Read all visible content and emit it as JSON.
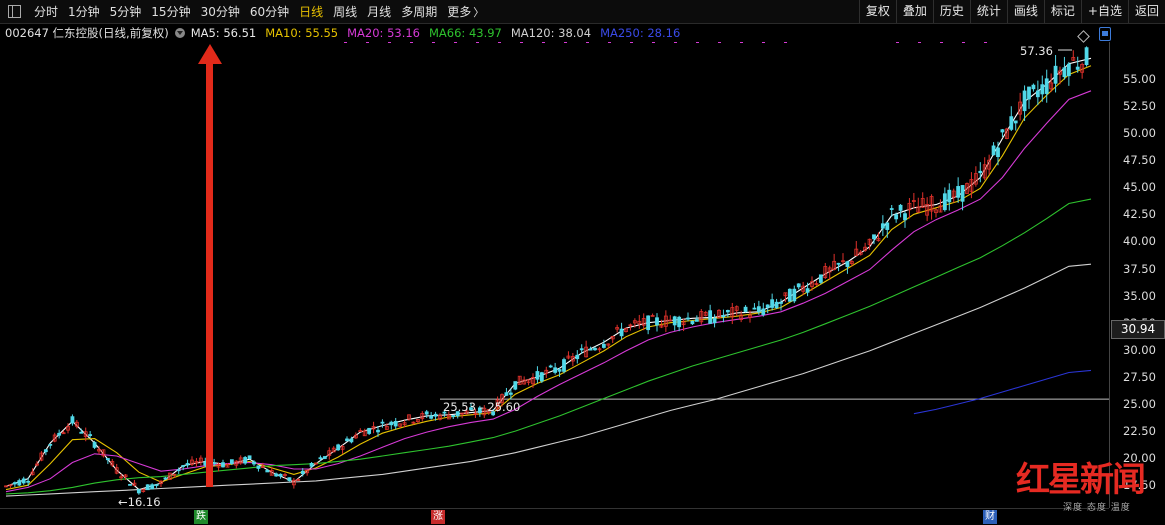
{
  "toolbar": {
    "periods": [
      "分时",
      "1分钟",
      "5分钟",
      "15分钟",
      "30分钟",
      "60分钟",
      "日线",
      "周线",
      "月线",
      "多周期",
      "更多"
    ],
    "active_period": "日线",
    "tools": [
      "复权",
      "叠加",
      "历史",
      "统计",
      "画线",
      "标记",
      "+自选",
      "返回"
    ]
  },
  "info": {
    "stock": "002647 仁东控股(日线,前复权)",
    "ma5": "MA5: 56.51",
    "ma10": "MA10: 55.55",
    "ma20": "MA20: 53.16",
    "ma66": "MA66: 43.97",
    "ma120": "MA120: 38.04",
    "ma250": "MA250: 28.16"
  },
  "colors": {
    "ma5": "#ffffff",
    "ma10": "#e6c200",
    "ma20": "#d63ad6",
    "ma66": "#2ec22e",
    "ma120": "#d0d0d0",
    "ma250": "#2a35d6",
    "up": "#e0312b",
    "down": "#51d8e8",
    "arrow": "#e22a1a"
  },
  "axis": {
    "ticks": [
      "55.00",
      "52.50",
      "50.00",
      "47.50",
      "45.00",
      "42.50",
      "40.00",
      "37.50",
      "35.00",
      "32.50",
      "30.00",
      "27.50",
      "25.00",
      "22.50",
      "20.00",
      "17.50"
    ],
    "current": "30.94"
  },
  "annotations": {
    "high": "57.36",
    "low": "16.16",
    "range": "25.53 - 25.60"
  },
  "markers": {
    "down": "跌",
    "up": "涨",
    "finance": "财"
  },
  "watermark": {
    "title": "红星新闻",
    "sub": "深度 态度 温度"
  },
  "chart_data": {
    "type": "line",
    "title": "",
    "ylim": [
      15.5,
      58.5
    ],
    "series": [
      {
        "name": "MA5",
        "values": [
          17.5,
          18.2,
          21.5,
          23.5,
          21.5,
          19.0,
          17.2,
          17.8,
          19.4,
          19.8,
          19.5,
          20.0,
          18.8,
          17.9,
          19.6,
          21.0,
          22.5,
          23.1,
          23.6,
          24.0,
          24.1,
          24.3,
          24.5,
          27.0,
          27.6,
          28.4,
          29.8,
          30.8,
          32.1,
          32.6,
          32.8,
          33.0,
          33.1,
          33.5,
          33.6,
          34.5,
          35.8,
          37.1,
          38.2,
          39.6,
          42.5,
          43.2,
          43.5,
          44.3,
          46.0,
          49.6,
          53.0,
          54.6,
          56.5,
          57.0
        ]
      },
      {
        "name": "MA10",
        "values": [
          17.2,
          17.6,
          19.6,
          21.8,
          21.9,
          20.6,
          18.8,
          17.9,
          18.6,
          19.3,
          19.5,
          19.8,
          19.2,
          18.6,
          19.2,
          20.2,
          21.4,
          22.4,
          23.0,
          23.5,
          23.9,
          24.1,
          24.3,
          26.0,
          27.0,
          27.8,
          28.9,
          30.0,
          31.3,
          32.2,
          32.6,
          32.8,
          33.0,
          33.2,
          33.5,
          34.0,
          35.2,
          36.4,
          37.6,
          38.8,
          41.2,
          42.6,
          43.2,
          43.8,
          45.0,
          48.0,
          51.5,
          53.6,
          55.5,
          56.3
        ]
      },
      {
        "name": "MA20",
        "values": [
          17.0,
          17.4,
          18.2,
          19.7,
          20.5,
          20.3,
          19.6,
          18.9,
          19.1,
          19.4,
          19.6,
          19.7,
          19.5,
          19.1,
          19.1,
          19.6,
          20.3,
          21.1,
          21.9,
          22.5,
          23.0,
          23.4,
          23.7,
          24.6,
          25.8,
          26.9,
          27.9,
          28.9,
          30.0,
          31.0,
          31.7,
          32.2,
          32.6,
          32.9,
          33.2,
          33.6,
          34.4,
          35.3,
          36.4,
          37.5,
          39.3,
          41.0,
          42.1,
          43.0,
          44.0,
          46.0,
          48.7,
          51.0,
          53.2,
          54.0
        ]
      },
      {
        "name": "MA66",
        "values": [
          16.8,
          16.9,
          17.1,
          17.4,
          17.8,
          18.1,
          18.3,
          18.4,
          18.6,
          18.8,
          19.0,
          19.2,
          19.4,
          19.5,
          19.6,
          19.8,
          20.0,
          20.3,
          20.6,
          20.9,
          21.2,
          21.6,
          22.0,
          22.6,
          23.3,
          24.0,
          24.8,
          25.6,
          26.4,
          27.2,
          27.9,
          28.6,
          29.2,
          29.8,
          30.4,
          31.0,
          31.7,
          32.5,
          33.3,
          34.1,
          35.0,
          35.9,
          36.8,
          37.7,
          38.6,
          39.7,
          40.9,
          42.2,
          43.6,
          44.0
        ]
      },
      {
        "name": "MA120",
        "values": [
          16.6,
          16.7,
          16.8,
          16.9,
          17.0,
          17.1,
          17.2,
          17.3,
          17.4,
          17.5,
          17.6,
          17.7,
          17.8,
          17.9,
          18.0,
          18.2,
          18.4,
          18.6,
          18.9,
          19.2,
          19.5,
          19.8,
          20.2,
          20.6,
          21.1,
          21.6,
          22.1,
          22.7,
          23.3,
          23.9,
          24.5,
          25.0,
          25.5,
          26.1,
          26.7,
          27.3,
          27.9,
          28.6,
          29.3,
          30.0,
          30.8,
          31.6,
          32.4,
          33.2,
          34.0,
          34.9,
          35.8,
          36.8,
          37.8,
          38.0
        ]
      },
      {
        "name": "MA250",
        "values": [
          null,
          null,
          null,
          null,
          null,
          null,
          null,
          null,
          null,
          null,
          null,
          null,
          null,
          null,
          null,
          null,
          null,
          null,
          null,
          null,
          null,
          null,
          null,
          null,
          null,
          null,
          null,
          null,
          null,
          null,
          null,
          null,
          null,
          null,
          null,
          null,
          null,
          null,
          null,
          null,
          null,
          24.2,
          24.6,
          25.1,
          25.6,
          26.2,
          26.8,
          27.4,
          28.0,
          28.2
        ]
      }
    ]
  }
}
